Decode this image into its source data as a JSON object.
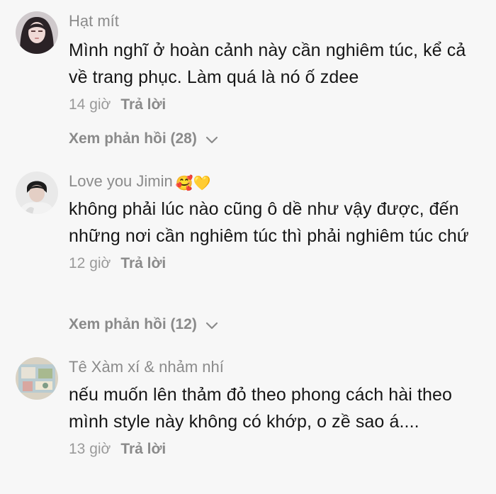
{
  "comments": [
    {
      "username": "Hạt mít",
      "emoji": "",
      "text": "Mình nghĩ ở hoàn cảnh này cần nghiêm túc, kể cả về trang phục. Làm quá là nó ố zdee",
      "time": "14 giờ",
      "reply_label": "Trả lời",
      "view_replies": "Xem phản hồi (28)"
    },
    {
      "username": "Love you Jimin",
      "emoji": "🥰💛",
      "text": "không phải lúc nào cũng ô dề như vậy được, đến những nơi cần nghiêm túc thì phải nghiêm túc chứ",
      "time": "12 giờ",
      "reply_label": "Trả lời",
      "view_replies": "Xem phản hồi (12)"
    },
    {
      "username": "Tê Xàm xí & nhảm nhí",
      "emoji": "",
      "text": "nếu muốn lên thảm đỏ theo phong cách hài theo mình style này không có khớp, o zề sao á....",
      "time": "13 giờ",
      "reply_label": "Trả lời"
    }
  ],
  "colors": {
    "background": "#f7f7f7",
    "username": "#8b8b8b",
    "text": "#161616",
    "meta": "#9a9a9a"
  },
  "icons": {
    "expand": "chevron-down-icon"
  }
}
